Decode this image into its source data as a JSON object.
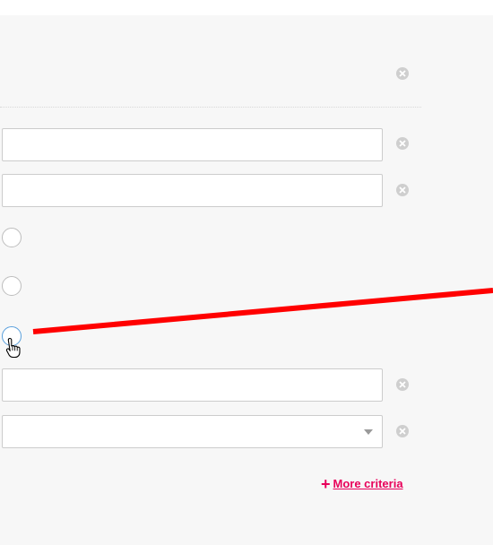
{
  "panel": {
    "fields": [
      {
        "value": "",
        "placeholder": ""
      },
      {
        "value": "",
        "placeholder": ""
      },
      {
        "value": "",
        "placeholder": ""
      }
    ],
    "select": {
      "value": ""
    },
    "more_criteria": {
      "plus": "+",
      "label": "More criteria"
    }
  },
  "colors": {
    "accent": "#e8005a",
    "annotation": "#ff0000",
    "radio_hover": "#5aa0dc",
    "remove_icon": "#cfcfcf"
  },
  "icons": {
    "remove": "remove-circle-x-icon",
    "cursor": "hand-pointer-cursor-icon",
    "dropdown": "chevron-down-icon"
  }
}
